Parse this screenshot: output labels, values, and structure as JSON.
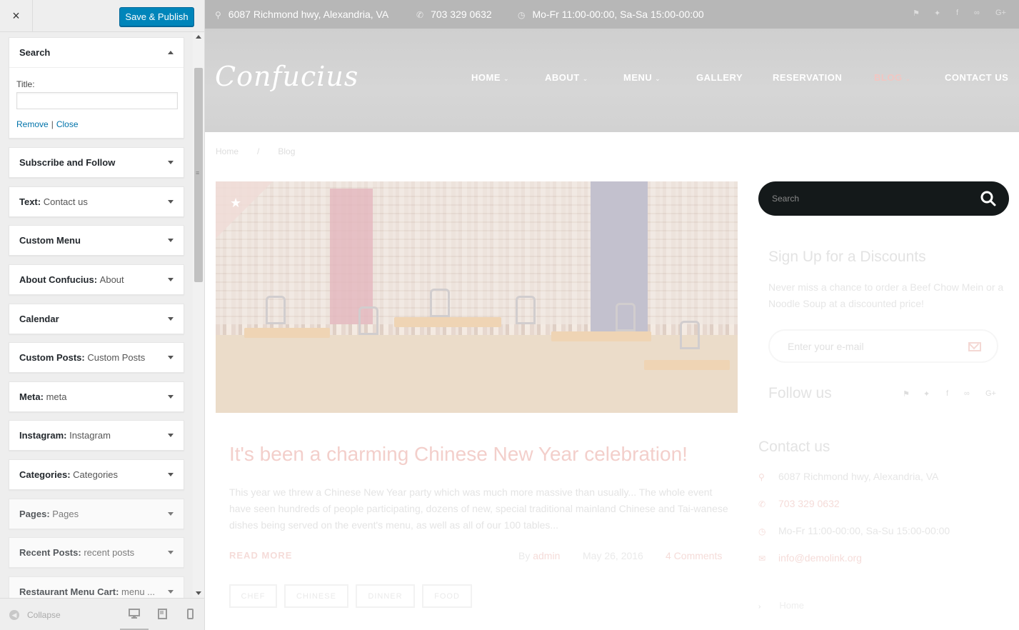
{
  "customizer": {
    "close_label": "×",
    "publish_label": "Save & Publish",
    "open_widget": {
      "name": "Search",
      "title_label": "Title:",
      "title_value": "",
      "remove_label": "Remove",
      "sep": "|",
      "close_label": "Close"
    },
    "widgets": [
      {
        "name": "Subscribe and Follow",
        "title": ""
      },
      {
        "name": "Text",
        "title": "Contact us"
      },
      {
        "name": "Custom Menu",
        "title": ""
      },
      {
        "name": "About Confucius",
        "title": "About"
      },
      {
        "name": "Calendar",
        "title": ""
      },
      {
        "name": "Custom Posts",
        "title": "Custom Posts"
      },
      {
        "name": "Meta",
        "title": "meta"
      },
      {
        "name": "Instagram",
        "title": "Instagram"
      },
      {
        "name": "Categories",
        "title": "Categories"
      },
      {
        "name": "Pages",
        "title": "Pages"
      },
      {
        "name": "Recent Posts",
        "title": "recent posts"
      },
      {
        "name": "Restaurant Menu Cart",
        "title": "menu ..."
      }
    ],
    "collapse_label": "Collapse"
  },
  "site": {
    "topbar": {
      "address": "6087 Richmond hwy, Alexandria, VA",
      "phone": "703 329 0632",
      "hours": "Mo-Fr 11:00-00:00, Sa-Sa 15:00-00:00"
    },
    "logo": "Confucius",
    "nav": [
      {
        "label": "HOME",
        "dropdown": true
      },
      {
        "label": "ABOUT",
        "dropdown": true
      },
      {
        "label": "MENU",
        "dropdown": true
      },
      {
        "label": "GALLERY",
        "dropdown": false
      },
      {
        "label": "RESERVATION",
        "dropdown": false
      },
      {
        "label": "BLOG",
        "dropdown": true,
        "active": true
      },
      {
        "label": "CONTACT US",
        "dropdown": false
      }
    ],
    "breadcrumb": {
      "home": "Home",
      "sep": "/",
      "current": "Blog"
    },
    "post": {
      "title": "It's been a charming Chinese New Year celebration!",
      "excerpt": "This year we threw a Chinese New Year party which was much more massive than usually... The whole event have seen hundreds of people participating, dozens of new, special traditional mainland Chinese and Tai-wanese dishes being served on the event's menu, as well as all of our 100 tables...",
      "read_more": "READ MORE",
      "by": "By",
      "author": "admin",
      "date": "May 26, 2016",
      "comments": "4 Comments",
      "tags": [
        "CHEF",
        "CHINESE",
        "DINNER",
        "FOOD"
      ]
    },
    "sidebar": {
      "search_placeholder": "Search",
      "signup_title": "Sign Up for a Discounts",
      "signup_text": "Never miss a chance to order a Beef Chow Mein or a Noodle Soup at a discounted price!",
      "email_placeholder": "Enter your e-mail",
      "follow_title": "Follow us",
      "contact_title": "Contact us",
      "contact": {
        "address": "6087 Richmond hwy, Alexandria, VA",
        "phone": "703 329 0632",
        "hours": "Mo-Fr 11:00-00:00, Sa-Su 15:00-00:00",
        "email": "info@demolink.org"
      },
      "next_link": "Home"
    }
  },
  "colors": {
    "publish_button": "#0085ba",
    "link": "#0073aa",
    "topbar": "#b7b7b7",
    "accent": "#f3cfcb",
    "search_bg": "#14191a"
  }
}
